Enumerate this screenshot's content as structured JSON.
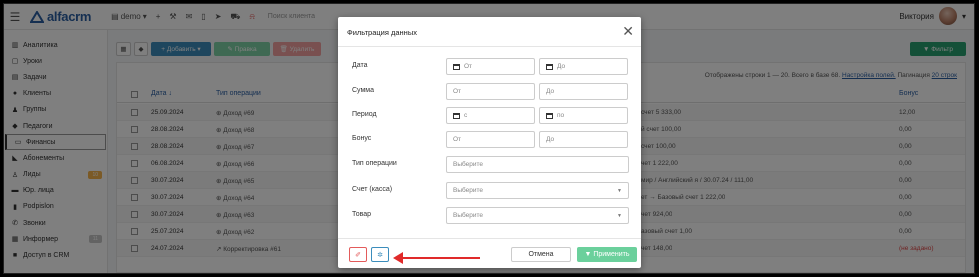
{
  "topbar": {
    "logo_text": "alfacrm",
    "branch": "demo",
    "search_placeholder": "Поиск клиента",
    "user_name": "Виктория"
  },
  "sidebar": {
    "items": [
      {
        "label": "Аналитика",
        "icon": "bar-chart-icon"
      },
      {
        "label": "Уроки",
        "icon": "calendar-icon"
      },
      {
        "label": "Задачи",
        "icon": "task-icon"
      },
      {
        "label": "Клиенты",
        "icon": "user-icon"
      },
      {
        "label": "Группы",
        "icon": "group-icon"
      },
      {
        "label": "Педагоги",
        "icon": "graduation-cap-icon"
      },
      {
        "label": "Финансы",
        "icon": "money-icon"
      },
      {
        "label": "Абонементы",
        "icon": "tag-icon"
      },
      {
        "label": "Лиды",
        "icon": "leads-icon",
        "badge": "10"
      },
      {
        "label": "Юр. лица",
        "icon": "id-card-icon"
      },
      {
        "label": "Podpislon",
        "icon": "document-icon"
      },
      {
        "label": "Звонки",
        "icon": "phone-icon"
      },
      {
        "label": "Информер",
        "icon": "envelope-icon",
        "badge": "11"
      },
      {
        "label": "Доступ в CRM",
        "icon": "lock-icon"
      }
    ],
    "active_index": 6
  },
  "toolbar": {
    "add_label": "+ Добавить ▾",
    "edit_label": "✎ Правка",
    "delete_label": "🗑 Удалить",
    "filter_label": "▼ Фильтр"
  },
  "table": {
    "info_text": "Отображены строки 1 — 20. Всего в базе 68.",
    "settings_link": "Настройка полей.",
    "pagination_text": "Пагинация",
    "pagination_link": "20 строк",
    "headers": {
      "date": "Дата ↓",
      "type": "Тип операции",
      "bonus": "Бонус"
    },
    "rows": [
      {
        "date": "25.09.2024",
        "type": "⊕ Доход #69",
        "account": "счет 5 333,00",
        "bonus": "12,00"
      },
      {
        "date": "28.08.2024",
        "type": "⊕ Доход #68",
        "account": "й счет 100,00",
        "bonus": "0,00"
      },
      {
        "date": "28.08.2024",
        "type": "⊕ Доход #67",
        "account": "счет 100,00",
        "bonus": "0,00"
      },
      {
        "date": "06.08.2024",
        "type": "⊕ Доход #66",
        "account": "чет 1 222,00",
        "bonus": "0,00"
      },
      {
        "date": "30.07.2024",
        "type": "⊕ Доход #65",
        "account": "мир / Английский я / 30.07.24 / 111,00",
        "bonus": "0,00"
      },
      {
        "date": "30.07.2024",
        "type": "⊕ Доход #64",
        "account": "ет → Базовый счет 1 222,00",
        "bonus": "0,00"
      },
      {
        "date": "30.07.2024",
        "type": "⊕ Доход #63",
        "account": "чет 924,00",
        "bonus": "0,00"
      },
      {
        "date": "25.07.2024",
        "type": "⊕ Доход #62",
        "account": "азовый счет 1,00",
        "bonus": "0,00"
      },
      {
        "date": "24.07.2024",
        "type": "↗ Корректировка #61",
        "account": "чет 148,00",
        "bonus": "(не задано)"
      }
    ]
  },
  "modal": {
    "title": "Фильтрация данных",
    "fields": [
      {
        "label": "Дата",
        "from": "От",
        "to": "До"
      },
      {
        "label": "Сумма",
        "from": "От",
        "to": "До"
      },
      {
        "label": "Период",
        "from": "с",
        "to": "по"
      },
      {
        "label": "Бонус",
        "from": "От",
        "to": "До"
      },
      {
        "label": "Тип операции",
        "placeholder": "Выберите"
      },
      {
        "label": "Счет (касса)",
        "placeholder": "Выберите"
      },
      {
        "label": "Товар",
        "placeholder": "Выберите"
      }
    ],
    "cancel_label": "Отмена",
    "apply_label": "▼ Применить"
  },
  "colors": {
    "brand": "#2a5fa3",
    "primary_button": "#3c8dbc",
    "success_button": "#28a070",
    "apply_button": "#6bd09c",
    "danger": "#e35b5b",
    "annotation_arrow": "#e02a2a"
  }
}
